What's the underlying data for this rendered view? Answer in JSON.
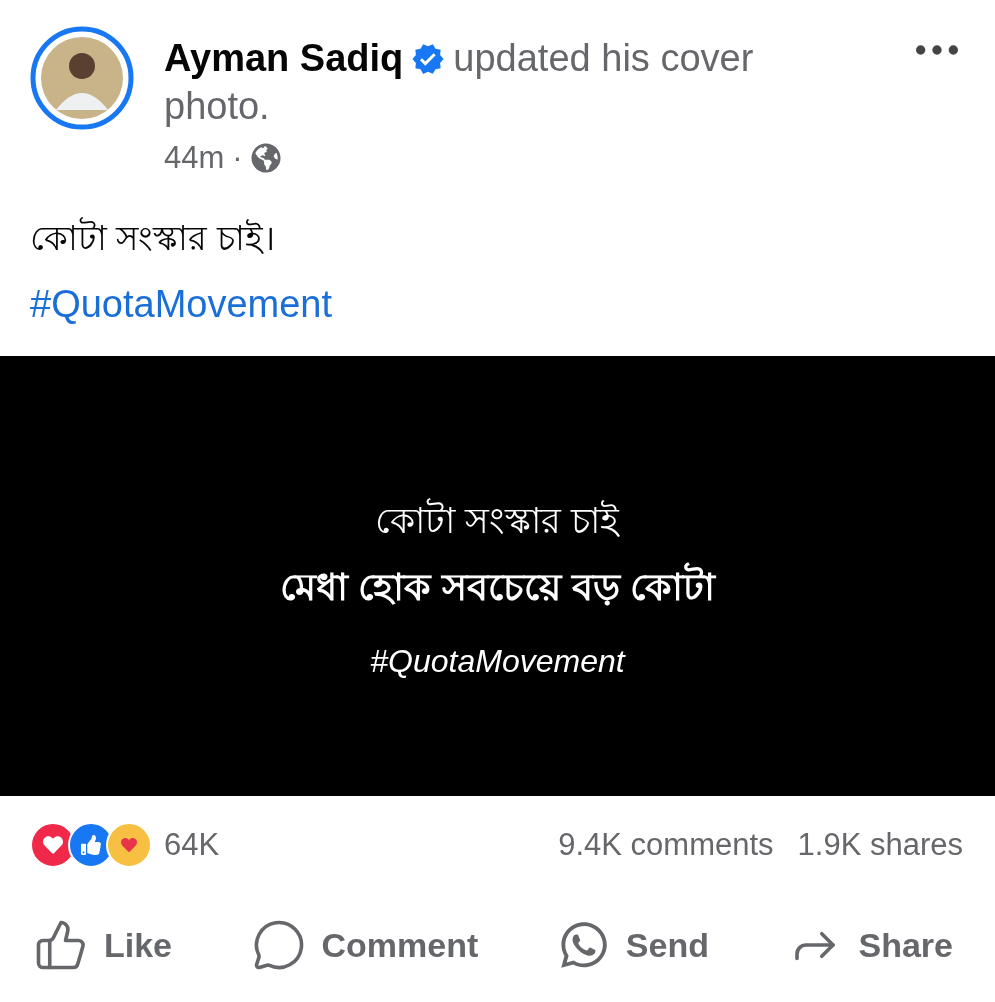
{
  "post": {
    "author": "Ayman Sadiq",
    "verified": true,
    "action": "updated his cover photo.",
    "time": "44m",
    "separator": "·",
    "public": true,
    "caption": "কোটা সংস্কার চাই।",
    "hashtag": "#QuotaMovement"
  },
  "cover": {
    "lines": [
      {
        "kind": "title",
        "text": "কোটা সংস্কার চাই"
      },
      {
        "kind": "headline",
        "text": "মেধা হোক সবচেয়ে বড় কোটা"
      },
      {
        "kind": "tag",
        "text": "#QuotaMovement"
      }
    ]
  },
  "reactions": {
    "items": [
      {
        "kind": "love"
      },
      {
        "kind": "like"
      },
      {
        "kind": "care"
      }
    ],
    "count": "64K"
  },
  "comments": "9.4K comments",
  "shares": "1.9K shares",
  "actions": [
    {
      "kind": "like",
      "label": "Like"
    },
    {
      "kind": "comment",
      "label": "Comment"
    },
    {
      "kind": "send",
      "label": "Send"
    },
    {
      "kind": "share",
      "label": "Share"
    }
  ]
}
